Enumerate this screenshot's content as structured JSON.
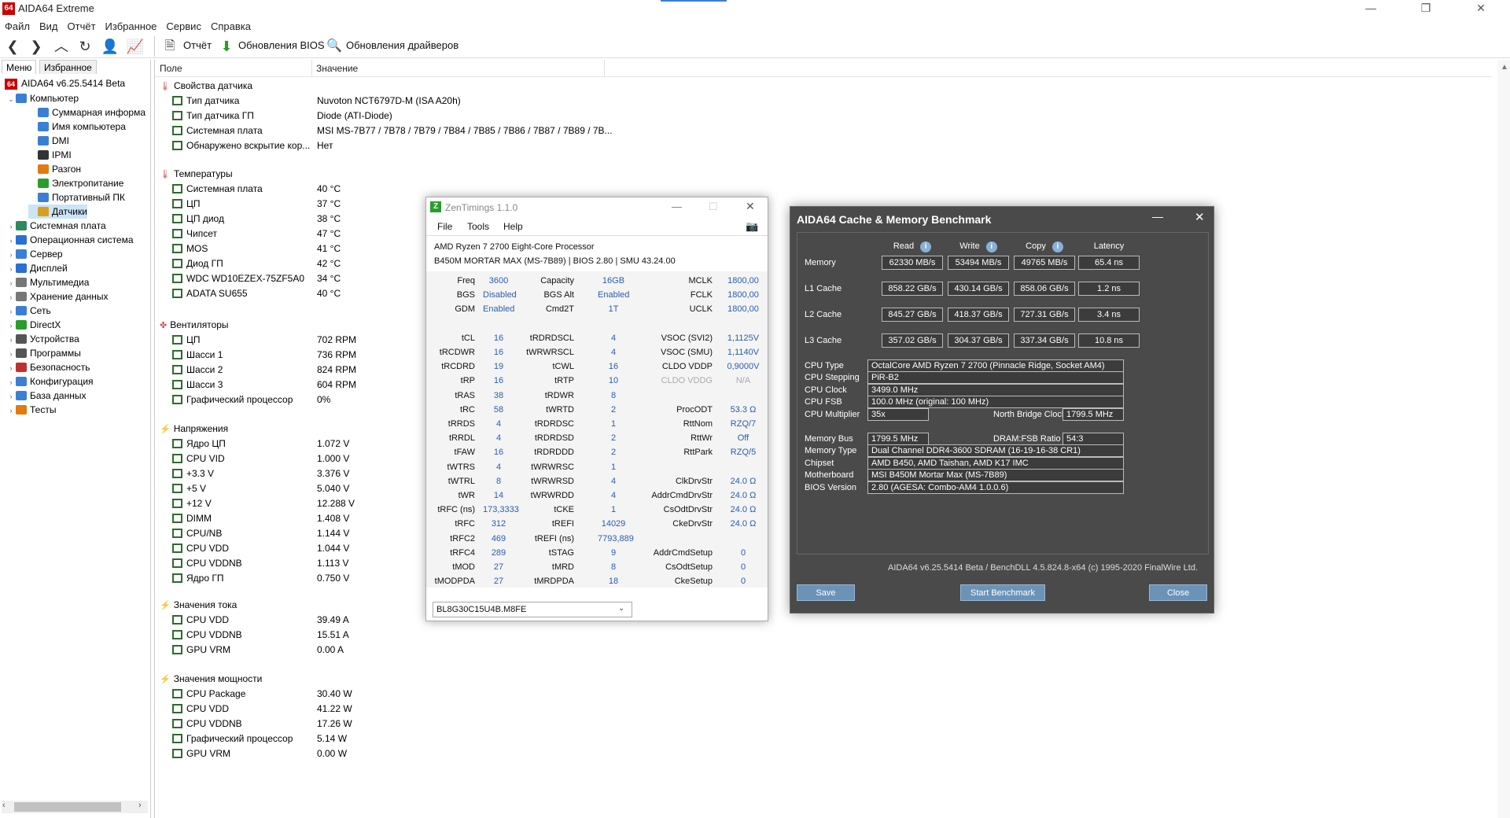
{
  "window": {
    "title": "AIDA64 Extreme",
    "app_icon": "64"
  },
  "menu": [
    "Файл",
    "Вид",
    "Отчёт",
    "Избранное",
    "Сервис",
    "Справка"
  ],
  "toolbar": {
    "report": "Отчёт",
    "bios": "Обновления BIOS",
    "drivers": "Обновления драйверов"
  },
  "left": {
    "tabs": [
      "Меню",
      "Избранное"
    ],
    "root": "AIDA64 v6.25.5414 Beta",
    "tree": [
      {
        "label": "Компьютер",
        "level": 1,
        "exp": "v",
        "color": "#3b7fd4"
      },
      {
        "label": "Суммарная информа",
        "level": 2,
        "exp": "",
        "color": "#3b7fd4"
      },
      {
        "label": "Имя компьютера",
        "level": 2,
        "exp": "",
        "color": "#3b7fd4"
      },
      {
        "label": "DMI",
        "level": 2,
        "exp": "",
        "color": "#3b7fd4"
      },
      {
        "label": "IPMI",
        "level": 2,
        "exp": "",
        "color": "#333"
      },
      {
        "label": "Разгон",
        "level": 2,
        "exp": "",
        "color": "#e07b10"
      },
      {
        "label": "Электропитание",
        "level": 2,
        "exp": "",
        "color": "#2a9d2a"
      },
      {
        "label": "Портативный ПК",
        "level": 2,
        "exp": "",
        "color": "#3b7fd4"
      },
      {
        "label": "Датчики",
        "level": 2,
        "exp": "",
        "color": "#d8a020",
        "selected": true
      },
      {
        "label": "Системная плата",
        "level": 1,
        "exp": ">",
        "color": "#2a8a5a"
      },
      {
        "label": "Операционная система",
        "level": 1,
        "exp": ">",
        "color": "#2a6fd4"
      },
      {
        "label": "Сервер",
        "level": 1,
        "exp": ">",
        "color": "#3b7fd4"
      },
      {
        "label": "Дисплей",
        "level": 1,
        "exp": ">",
        "color": "#2a6fd4"
      },
      {
        "label": "Мультимедиа",
        "level": 1,
        "exp": ">",
        "color": "#777"
      },
      {
        "label": "Хранение данных",
        "level": 1,
        "exp": ">",
        "color": "#777"
      },
      {
        "label": "Сеть",
        "level": 1,
        "exp": ">",
        "color": "#3b7fd4"
      },
      {
        "label": "DirectX",
        "level": 1,
        "exp": ">",
        "color": "#2a9d2a"
      },
      {
        "label": "Устройства",
        "level": 1,
        "exp": ">",
        "color": "#555"
      },
      {
        "label": "Программы",
        "level": 1,
        "exp": ">",
        "color": "#555"
      },
      {
        "label": "Безопасность",
        "level": 1,
        "exp": ">",
        "color": "#c03030"
      },
      {
        "label": "Конфигурация",
        "level": 1,
        "exp": ">",
        "color": "#3b7fd4"
      },
      {
        "label": "База данных",
        "level": 1,
        "exp": ">",
        "color": "#3b7fd4"
      },
      {
        "label": "Тесты",
        "level": 1,
        "exp": ">",
        "color": "#e07b10"
      }
    ]
  },
  "table": {
    "col_field": "Поле",
    "col_value": "Значение",
    "groups": [
      {
        "title": "Свойства датчика",
        "rows": [
          [
            "Тип датчика",
            "Nuvoton NCT6797D-M  (ISA A20h)"
          ],
          [
            "Тип датчика ГП",
            "Diode  (ATI-Diode)"
          ],
          [
            "Системная плата",
            "MSI MS-7B77 / 7B78 / 7B79 / 7B84 / 7B85 / 7B86 / 7B87 / 7B89 / 7B..."
          ],
          [
            "Обнаружено вскрытие кор...",
            "Нет"
          ]
        ]
      },
      {
        "title": "Температуры",
        "rows": [
          [
            "Системная плата",
            "40 °C"
          ],
          [
            "ЦП",
            "37 °C"
          ],
          [
            "ЦП диод",
            "38 °C"
          ],
          [
            "Чипсет",
            "47 °C"
          ],
          [
            "MOS",
            "41 °C"
          ],
          [
            "Диод ГП",
            "42 °C"
          ],
          [
            "WDC WD10EZEX-75ZF5A0",
            "34 °C"
          ],
          [
            "ADATA SU655",
            "40 °C"
          ]
        ]
      },
      {
        "title": "Вентиляторы",
        "rows": [
          [
            "ЦП",
            "702 RPM"
          ],
          [
            "Шасси 1",
            "736 RPM"
          ],
          [
            "Шасси 2",
            "824 RPM"
          ],
          [
            "Шасси 3",
            "604 RPM"
          ],
          [
            "Графический процессор",
            "0%"
          ]
        ]
      },
      {
        "title": "Напряжения",
        "rows": [
          [
            "Ядро ЦП",
            "1.072 V"
          ],
          [
            "CPU VID",
            "1.000 V"
          ],
          [
            "+3.3 V",
            "3.376 V"
          ],
          [
            "+5 V",
            "5.040 V"
          ],
          [
            "+12 V",
            "12.288 V"
          ],
          [
            "DIMM",
            "1.408 V"
          ],
          [
            "CPU/NB",
            "1.144 V"
          ],
          [
            "CPU VDD",
            "1.044 V"
          ],
          [
            "CPU VDDNB",
            "1.113 V"
          ],
          [
            "Ядро ГП",
            "0.750 V"
          ]
        ]
      },
      {
        "title": "Значения тока",
        "rows": [
          [
            "CPU VDD",
            "39.49 A"
          ],
          [
            "CPU VDDNB",
            "15.51 A"
          ],
          [
            "GPU VRM",
            "0.00 A"
          ]
        ]
      },
      {
        "title": "Значения мощности",
        "rows": [
          [
            "CPU Package",
            "30.40 W"
          ],
          [
            "CPU VDD",
            "41.22 W"
          ],
          [
            "CPU VDDNB",
            "17.26 W"
          ],
          [
            "Графический процессор",
            "5.14 W"
          ],
          [
            "GPU VRM",
            "0.00 W"
          ]
        ]
      }
    ]
  },
  "zen": {
    "title": "ZenTimings 1.1.0",
    "menu": [
      "File",
      "Tools",
      "Help"
    ],
    "cpu": "AMD Ryzen 7 2700 Eight-Core Processor",
    "board": "B450M MORTAR MAX (MS-7B89) | BIOS 2.80 | SMU 43.24.00",
    "rows": [
      [
        "Freq",
        "3600",
        "Capacity",
        "16GB",
        "MCLK",
        "1800,00"
      ],
      [
        "BGS",
        "Disabled",
        "BGS Alt",
        "Enabled",
        "FCLK",
        "1800,00"
      ],
      [
        "GDM",
        "Enabled",
        "Cmd2T",
        "1T",
        "UCLK",
        "1800,00"
      ],
      null,
      [
        "tCL",
        "16",
        "tRDRDSCL",
        "4",
        "VSOC (SVI2)",
        "1,1125V"
      ],
      [
        "tRCDWR",
        "16",
        "tWRWRSCL",
        "4",
        "VSOC (SMU)",
        "1,1140V"
      ],
      [
        "tRCDRD",
        "19",
        "tCWL",
        "16",
        "CLDO VDDP",
        "0,9000V"
      ],
      [
        "tRP",
        "16",
        "tRTP",
        "10",
        "CLDO VDDG",
        "N/A"
      ],
      [
        "tRAS",
        "38",
        "tRDWR",
        "8",
        "",
        ""
      ],
      [
        "tRC",
        "58",
        "tWRTD",
        "2",
        "ProcODT",
        "53.3 Ω"
      ],
      [
        "tRRDS",
        "4",
        "tRDRDSC",
        "1",
        "RttNom",
        "RZQ/7"
      ],
      [
        "tRRDL",
        "4",
        "tRDRDSD",
        "2",
        "RttWr",
        "Off"
      ],
      [
        "tFAW",
        "16",
        "tRDRDDD",
        "2",
        "RttPark",
        "RZQ/5"
      ],
      [
        "tWTRS",
        "4",
        "tWRWRSC",
        "1",
        "",
        ""
      ],
      [
        "tWTRL",
        "8",
        "tWRWRSD",
        "4",
        "ClkDrvStr",
        "24.0 Ω"
      ],
      [
        "tWR",
        "14",
        "tWRWRDD",
        "4",
        "AddrCmdDrvStr",
        "24.0 Ω"
      ],
      [
        "tRFC (ns)",
        "173,3333",
        "tCKE",
        "1",
        "CsOdtDrvStr",
        "24.0 Ω"
      ],
      [
        "tRFC",
        "312",
        "tREFI",
        "14029",
        "CkeDrvStr",
        "24.0 Ω"
      ],
      [
        "tRFC2",
        "469",
        "tREFI (ns)",
        "7793,889",
        "",
        ""
      ],
      [
        "tRFC4",
        "289",
        "tSTAG",
        "9",
        "AddrCmdSetup",
        "0"
      ],
      [
        "tMOD",
        "27",
        "tMRD",
        "8",
        "CsOdtSetup",
        "0"
      ],
      [
        "tMODPDA",
        "27",
        "tMRDPDA",
        "18",
        "CkeSetup",
        "0"
      ]
    ],
    "dropdown": "BL8G30C15U4B.M8FE"
  },
  "bench": {
    "title": "AIDA64 Cache & Memory Benchmark",
    "headers": [
      "Read",
      "Write",
      "Copy",
      "Latency"
    ],
    "rows": [
      {
        "label": "Memory",
        "vals": [
          "62330 MB/s",
          "53494 MB/s",
          "49765 MB/s",
          "65.4 ns"
        ]
      },
      {
        "label": "L1 Cache",
        "vals": [
          "858.22 GB/s",
          "430.14 GB/s",
          "858.06 GB/s",
          "1.2 ns"
        ]
      },
      {
        "label": "L2 Cache",
        "vals": [
          "845.27 GB/s",
          "418.37 GB/s",
          "727.31 GB/s",
          "3.4 ns"
        ]
      },
      {
        "label": "L3 Cache",
        "vals": [
          "357.02 GB/s",
          "304.37 GB/s",
          "337.34 GB/s",
          "10.8 ns"
        ]
      }
    ],
    "cpu_type_l": "CPU Type",
    "cpu_type": "OctalCore AMD Ryzen 7 2700  (Pinnacle Ridge, Socket AM4)",
    "cpu_step_l": "CPU Stepping",
    "cpu_step": "PiR-B2",
    "cpu_clock_l": "CPU Clock",
    "cpu_clock": "3499.0 MHz",
    "cpu_fsb_l": "CPU FSB",
    "cpu_fsb": "100.0 MHz  (original: 100 MHz)",
    "cpu_mult_l": "CPU Multiplier",
    "cpu_mult": "35x",
    "nb_clock_l": "North Bridge Clock",
    "nb_clock": "1799.5 MHz",
    "mem_bus_l": "Memory Bus",
    "mem_bus": "1799.5 MHz",
    "dram_ratio_l": "DRAM:FSB Ratio",
    "dram_ratio": "54:3",
    "mem_type_l": "Memory Type",
    "mem_type": "Dual Channel DDR4-3600 SDRAM  (16-19-16-38 CR1)",
    "chipset_l": "Chipset",
    "chipset": "AMD B450, AMD Taishan, AMD K17 IMC",
    "mobo_l": "Motherboard",
    "mobo": "MSI B450M Mortar Max (MS-7B89)",
    "bios_l": "BIOS Version",
    "bios": "2.80  (AGESA: Combo-AM4 1.0.0.6)",
    "footer": "AIDA64 v6.25.5414 Beta / BenchDLL 4.5.824.8-x64  (c) 1995-2020 FinalWire Ltd.",
    "save": "Save",
    "start": "Start Benchmark",
    "close": "Close"
  }
}
